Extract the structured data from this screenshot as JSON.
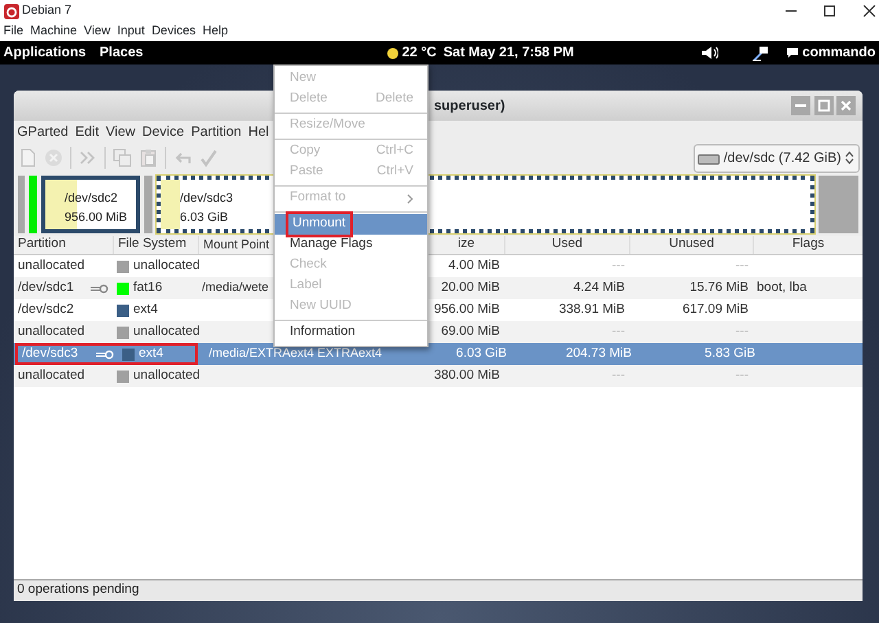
{
  "host_window": {
    "title": "Debian 7",
    "menu": [
      "File",
      "Machine",
      "View",
      "Input",
      "Devices",
      "Help"
    ]
  },
  "top_bar": {
    "menus": [
      "Applications",
      "Places"
    ],
    "weather": "22 °C",
    "clock": "Sat May 21,  7:58 PM",
    "user": "commando"
  },
  "gparted": {
    "title": "superuser)",
    "menu": [
      "GParted",
      "Edit",
      "View",
      "Device",
      "Partition",
      "Hel"
    ],
    "toolbar": [
      {
        "kind": "new",
        "disabled": true
      },
      {
        "kind": "delete",
        "disabled": true
      },
      {
        "kind": "separator"
      },
      {
        "kind": "resize",
        "disabled": true
      },
      {
        "kind": "separator"
      },
      {
        "kind": "copy",
        "disabled": true
      },
      {
        "kind": "paste",
        "disabled": true
      },
      {
        "kind": "separator"
      },
      {
        "kind": "undo",
        "disabled": true
      },
      {
        "kind": "apply",
        "disabled": true
      }
    ],
    "device": "/dev/sdc  (7.42 GiB)",
    "graph": [
      {
        "kind": "unallocated"
      },
      {
        "kind": "partition",
        "color": "#00ee00",
        "selected": false
      },
      {
        "kind": "partition",
        "color": "#2c4a6a",
        "label": "/dev/sdc2",
        "size": "956.00 MiB",
        "level": 0.35,
        "selected": false
      },
      {
        "kind": "unallocated"
      },
      {
        "kind": "partition",
        "color": "#2c4a6a",
        "label": "/dev/sdc3",
        "size": "6.03 GiB",
        "level": 0.03,
        "selected": true
      },
      {
        "kind": "unallocated"
      }
    ],
    "columns": [
      "Partition",
      "File System",
      "Mount Point",
      "ize",
      "Used",
      "Unused",
      "Flags"
    ],
    "rows": [
      {
        "partition": "unallocated",
        "mounted": false,
        "color": "#a0a0a0",
        "fs": "unallocated",
        "mount": "",
        "size": "4.00 MiB",
        "used": "---",
        "unused": "---",
        "flags": "",
        "selected": false,
        "annotated": false
      },
      {
        "partition": "/dev/sdc1",
        "mounted": true,
        "color": "#00ff00",
        "fs": "fat16",
        "mount": "/media/wete",
        "size": "20.00 MiB",
        "used": "4.24 MiB",
        "unused": "15.76 MiB",
        "flags": "boot, lba",
        "selected": false,
        "annotated": false
      },
      {
        "partition": "/dev/sdc2",
        "mounted": false,
        "color": "#3b5f86",
        "fs": "ext4",
        "mount": "",
        "size": "956.00 MiB",
        "used": "338.91 MiB",
        "unused": "617.09 MiB",
        "flags": "",
        "selected": false,
        "annotated": false
      },
      {
        "partition": "unallocated",
        "mounted": false,
        "color": "#a0a0a0",
        "fs": "unallocated",
        "mount": "",
        "size": "69.00 MiB",
        "used": "---",
        "unused": "---",
        "flags": "",
        "selected": false,
        "annotated": false
      },
      {
        "partition": "/dev/sdc3",
        "mounted": true,
        "color": "#3b5f86",
        "fs": "ext4",
        "mount": "/media/EXTRAext4  EXTRAext4",
        "size": "6.03 GiB",
        "used": "204.73 MiB",
        "unused": "5.83 GiB",
        "flags": "",
        "selected": true,
        "annotated": true
      },
      {
        "partition": "unallocated",
        "mounted": false,
        "color": "#a0a0a0",
        "fs": "unallocated",
        "mount": "",
        "size": "380.00 MiB",
        "used": "---",
        "unused": "---",
        "flags": "",
        "selected": false,
        "annotated": false
      }
    ],
    "status": "0 operations pending"
  },
  "context_menu": [
    {
      "kind": "item",
      "label": "New",
      "disabled": true,
      "selected": false,
      "annotated": false
    },
    {
      "kind": "item",
      "label": "Delete",
      "shortcut": "Delete",
      "disabled": true,
      "selected": false,
      "annotated": false
    },
    {
      "kind": "separator"
    },
    {
      "kind": "item",
      "label": "Resize/Move",
      "disabled": true,
      "selected": false,
      "annotated": false
    },
    {
      "kind": "separator"
    },
    {
      "kind": "item",
      "label": "Copy",
      "shortcut": "Ctrl+C",
      "disabled": true,
      "selected": false,
      "annotated": false
    },
    {
      "kind": "item",
      "label": "Paste",
      "shortcut": "Ctrl+V",
      "disabled": true,
      "selected": false,
      "annotated": false
    },
    {
      "kind": "separator"
    },
    {
      "kind": "submenu",
      "label": "Format to",
      "disabled": true,
      "selected": false,
      "annotated": false
    },
    {
      "kind": "separator"
    },
    {
      "kind": "item",
      "label": "Unmount",
      "disabled": false,
      "selected": true,
      "annotated": true
    },
    {
      "kind": "item",
      "label": "Manage Flags",
      "disabled": false,
      "selected": false,
      "annotated": false
    },
    {
      "kind": "item",
      "label": "Check",
      "disabled": true,
      "selected": false,
      "annotated": false
    },
    {
      "kind": "item",
      "label": "Label",
      "disabled": true,
      "selected": false,
      "annotated": false
    },
    {
      "kind": "item",
      "label": "New UUID",
      "disabled": true,
      "selected": false,
      "annotated": false
    },
    {
      "kind": "separator"
    },
    {
      "kind": "item",
      "label": "Information",
      "disabled": false,
      "selected": false,
      "annotated": false
    }
  ]
}
